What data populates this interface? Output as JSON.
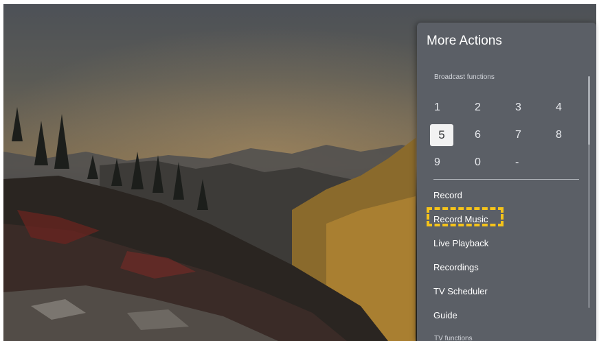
{
  "panel": {
    "title": "More Actions",
    "broadcast_label": "Broadcast functions",
    "tv_label": "TV functions",
    "number_keys": [
      "1",
      "2",
      "3",
      "4",
      "5",
      "6",
      "7",
      "8",
      "9",
      "0",
      "-"
    ],
    "selected_key": "5",
    "menu_items": [
      "Record",
      "Record Music",
      "Live Playback",
      "Recordings",
      "TV Scheduler",
      "Guide"
    ],
    "highlighted_item": "Record Music"
  },
  "colors": {
    "panel_bg": "#5b5f66",
    "highlight": "#f5c31a"
  }
}
